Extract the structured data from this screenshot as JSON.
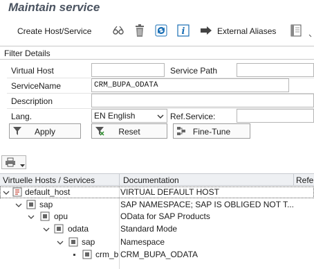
{
  "app": {
    "title": "Maintain service"
  },
  "toolbar": {
    "create_label": "Create Host/Service",
    "external_aliases_label": "External Aliases",
    "icons": [
      "glasses-icon",
      "trash-icon",
      "refresh-icon",
      "info-icon",
      "arrow-right-icon",
      "layout-icon"
    ]
  },
  "filter": {
    "section_title": "Filter Details",
    "virtual_host_label": "Virtual Host",
    "virtual_host_value": "",
    "service_path_label": "Service Path",
    "service_path_value": "",
    "service_name_label": "ServiceName",
    "service_name_value": "CRM_BUPA_ODATA",
    "description_label": "Description",
    "description_value": "",
    "lang_label": "Lang.",
    "lang_value": "EN English",
    "ref_service_label": "Ref.Service:",
    "ref_service_value": "",
    "apply_label": "Apply",
    "reset_label": "Reset",
    "finetune_label": "Fine-Tune"
  },
  "grid": {
    "columns": [
      "Virtuelle Hosts / Services",
      "Documentation",
      "Refe"
    ],
    "rows": [
      {
        "name": "default_host",
        "doc": "VIRTUAL DEFAULT HOST"
      },
      {
        "name": "sap",
        "doc": "SAP NAMESPACE; SAP IS OBLIGED NOT T..."
      },
      {
        "name": "opu",
        "doc": "OData for SAP Products"
      },
      {
        "name": "odata",
        "doc": "Standard Mode"
      },
      {
        "name": "sap",
        "doc": "Namespace"
      },
      {
        "name": "crm_b",
        "doc": "CRM_BUPA_ODATA"
      }
    ]
  },
  "colors": {
    "title": "#4a5360",
    "accent_blue": "#1a6fb5",
    "grid_header": "#eef0f3"
  }
}
